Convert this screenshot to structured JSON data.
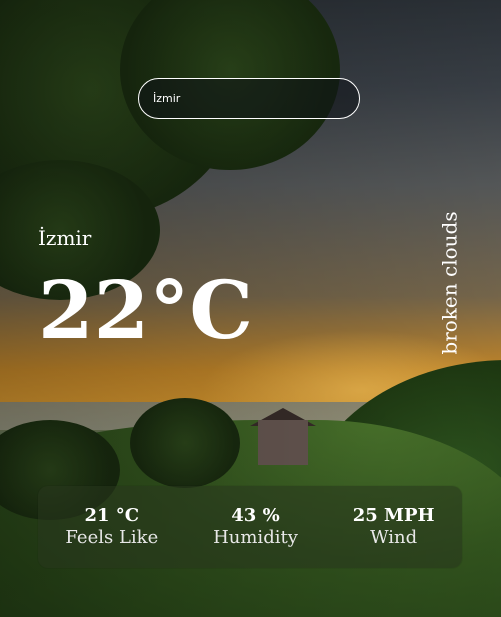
{
  "search": {
    "value": "İzmir"
  },
  "weather": {
    "city": "İzmir",
    "temperature": "22°C",
    "description": "broken clouds"
  },
  "stats": [
    {
      "value": "21 °C",
      "label": "Feels Like"
    },
    {
      "value": "43 %",
      "label": "Humidity"
    },
    {
      "value": "25 MPH",
      "label": "Wind"
    }
  ]
}
